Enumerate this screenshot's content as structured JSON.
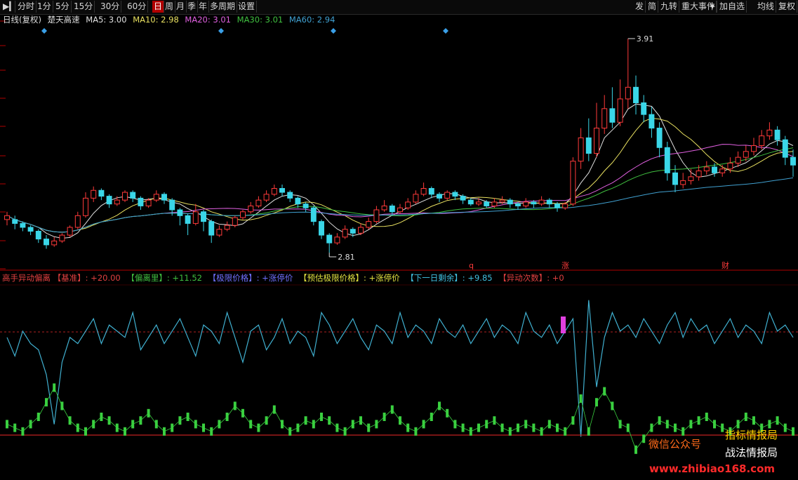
{
  "toolbar": {
    "items": [
      "分时",
      "1分",
      "5分",
      "15分",
      "30分",
      "60分",
      "日",
      "周",
      "月",
      "季",
      "年",
      "多周期",
      "设置"
    ],
    "active": "日",
    "right": [
      "发",
      "简",
      "九转",
      "重大事件",
      "加自选",
      "均线",
      "复权"
    ]
  },
  "main_title": {
    "period": "日线(复权)",
    "name": "楚天高速",
    "ma5": "MA5: 3.00",
    "ma10": "MA10: 2.98",
    "ma20": "MA20: 3.01",
    "ma30": "MA30: 3.01",
    "ma60": "MA60: 2.94",
    "colors": {
      "ma5": "#e0e0e0",
      "ma10": "#e8e060",
      "ma20": "#e060e0",
      "ma30": "#40c040",
      "ma60": "#40a0d0"
    }
  },
  "indicator_title": {
    "name": "高手异动偏离",
    "jizhun": "【基准】: +20.00",
    "pianli": "【偏离里】: +11.52",
    "jixian": "【极限价格】: +涨停价",
    "yugu": "【预估极限价格】: +涨停价",
    "shengyu": "【下一日剩余】: +9.85",
    "yidong": "【异动次数】: +0",
    "colors": {
      "name": "#e04040",
      "jizhun": "#e04040",
      "pianli": "#40c040",
      "jixian": "#7070ff",
      "yugu": "#e0e040",
      "shengyu": "#40c0e0",
      "yidong": "#e04040"
    }
  },
  "annotations": {
    "high": "3.91",
    "low": "2.81",
    "mark_q": "q",
    "mark_zhang": "涨",
    "mark_cai": "财"
  },
  "watermark": {
    "line1": "微信公众号",
    "line2": "指标情报局",
    "line3": "战法情报局",
    "url": "www.zhibiao168.com"
  },
  "chart_data": {
    "type": "candlestick",
    "price_range": [
      2.81,
      3.91
    ],
    "candles": [
      [
        2.98,
        3.0,
        2.95,
        3.02
      ],
      [
        2.98,
        2.96,
        2.93,
        3.0
      ],
      [
        2.96,
        2.94,
        2.92,
        2.97
      ],
      [
        2.94,
        2.92,
        2.9,
        2.95
      ],
      [
        2.92,
        2.88,
        2.86,
        2.93
      ],
      [
        2.88,
        2.85,
        2.83,
        2.9
      ],
      [
        2.85,
        2.87,
        2.84,
        2.89
      ],
      [
        2.87,
        2.9,
        2.86,
        2.91
      ],
      [
        2.9,
        2.94,
        2.89,
        2.95
      ],
      [
        2.94,
        3.0,
        2.93,
        3.02
      ],
      [
        3.0,
        3.09,
        2.99,
        3.12
      ],
      [
        3.09,
        3.13,
        3.07,
        3.15
      ],
      [
        3.13,
        3.1,
        3.08,
        3.14
      ],
      [
        3.1,
        3.06,
        3.04,
        3.11
      ],
      [
        3.06,
        3.08,
        3.05,
        3.1
      ],
      [
        3.08,
        3.12,
        3.07,
        3.13
      ],
      [
        3.12,
        3.09,
        3.07,
        3.13
      ],
      [
        3.09,
        3.05,
        3.03,
        3.1
      ],
      [
        3.05,
        3.08,
        3.04,
        3.09
      ],
      [
        3.08,
        3.11,
        3.07,
        3.13
      ],
      [
        3.11,
        3.08,
        3.06,
        3.12
      ],
      [
        3.08,
        3.03,
        3.0,
        3.09
      ],
      [
        3.03,
        3.0,
        2.95,
        3.04
      ],
      [
        3.0,
        2.96,
        2.9,
        3.01
      ],
      [
        2.96,
        3.02,
        2.95,
        3.06
      ],
      [
        3.02,
        2.97,
        2.92,
        3.03
      ],
      [
        2.97,
        2.9,
        2.86,
        2.98
      ],
      [
        2.9,
        2.93,
        2.89,
        2.95
      ],
      [
        2.93,
        2.95,
        2.92,
        2.97
      ],
      [
        2.95,
        2.99,
        2.94,
        3.0
      ],
      [
        2.99,
        3.02,
        2.98,
        3.03
      ],
      [
        3.02,
        3.05,
        3.01,
        3.07
      ],
      [
        3.05,
        3.08,
        3.04,
        3.1
      ],
      [
        3.08,
        3.11,
        3.07,
        3.13
      ],
      [
        3.11,
        3.14,
        3.1,
        3.16
      ],
      [
        3.14,
        3.12,
        3.1,
        3.16
      ],
      [
        3.12,
        3.09,
        3.07,
        3.13
      ],
      [
        3.09,
        3.06,
        3.04,
        3.1
      ],
      [
        3.06,
        3.04,
        3.02,
        3.07
      ],
      [
        3.04,
        2.97,
        2.95,
        3.05
      ],
      [
        2.97,
        2.9,
        2.88,
        2.98
      ],
      [
        2.9,
        2.86,
        2.81,
        2.91
      ],
      [
        2.86,
        2.89,
        2.85,
        2.91
      ],
      [
        2.89,
        2.93,
        2.88,
        2.95
      ],
      [
        2.93,
        2.91,
        2.89,
        2.94
      ],
      [
        2.91,
        2.94,
        2.9,
        2.96
      ],
      [
        2.94,
        2.97,
        2.93,
        2.99
      ],
      [
        2.97,
        3.03,
        2.96,
        3.05
      ],
      [
        3.03,
        3.05,
        3.02,
        3.08
      ],
      [
        3.05,
        3.02,
        3.0,
        3.06
      ],
      [
        3.02,
        3.04,
        3.01,
        3.06
      ],
      [
        3.04,
        3.07,
        3.03,
        3.09
      ],
      [
        3.07,
        3.11,
        3.06,
        3.13
      ],
      [
        3.11,
        3.14,
        3.1,
        3.17
      ],
      [
        3.14,
        3.11,
        3.09,
        3.15
      ],
      [
        3.11,
        3.09,
        3.07,
        3.12
      ],
      [
        3.09,
        3.12,
        3.08,
        3.13
      ],
      [
        3.12,
        3.1,
        3.08,
        3.13
      ],
      [
        3.1,
        3.08,
        3.06,
        3.11
      ],
      [
        3.08,
        3.06,
        3.05,
        3.09
      ],
      [
        3.06,
        3.07,
        3.05,
        3.09
      ],
      [
        3.07,
        3.05,
        3.04,
        3.08
      ],
      [
        3.05,
        3.07,
        3.04,
        3.09
      ],
      [
        3.07,
        3.08,
        3.06,
        3.1
      ],
      [
        3.08,
        3.06,
        3.04,
        3.09
      ],
      [
        3.06,
        3.05,
        3.03,
        3.07
      ],
      [
        3.05,
        3.07,
        3.04,
        3.09
      ],
      [
        3.07,
        3.06,
        3.04,
        3.08
      ],
      [
        3.06,
        3.08,
        3.05,
        3.1
      ],
      [
        3.08,
        3.06,
        3.04,
        3.09
      ],
      [
        3.06,
        3.04,
        3.02,
        3.07
      ],
      [
        3.04,
        3.06,
        3.03,
        3.07
      ],
      [
        3.06,
        3.28,
        3.05,
        3.3
      ],
      [
        3.28,
        3.4,
        3.24,
        3.45
      ],
      [
        3.4,
        3.32,
        3.28,
        3.5
      ],
      [
        3.32,
        3.45,
        3.3,
        3.58
      ],
      [
        3.45,
        3.55,
        3.42,
        3.62
      ],
      [
        3.55,
        3.48,
        3.45,
        3.66
      ],
      [
        3.48,
        3.6,
        3.46,
        3.7
      ],
      [
        3.6,
        3.66,
        3.55,
        3.91
      ],
      [
        3.66,
        3.58,
        3.52,
        3.72
      ],
      [
        3.58,
        3.52,
        3.48,
        3.62
      ],
      [
        3.52,
        3.45,
        3.4,
        3.56
      ],
      [
        3.45,
        3.35,
        3.3,
        3.48
      ],
      [
        3.35,
        3.22,
        3.18,
        3.38
      ],
      [
        3.22,
        3.16,
        3.12,
        3.26
      ],
      [
        3.16,
        3.18,
        3.14,
        3.22
      ],
      [
        3.18,
        3.2,
        3.16,
        3.24
      ],
      [
        3.2,
        3.23,
        3.18,
        3.26
      ],
      [
        3.23,
        3.25,
        3.21,
        3.28
      ],
      [
        3.25,
        3.22,
        3.2,
        3.27
      ],
      [
        3.22,
        3.24,
        3.2,
        3.26
      ],
      [
        3.24,
        3.27,
        3.22,
        3.3
      ],
      [
        3.27,
        3.3,
        3.25,
        3.33
      ],
      [
        3.3,
        3.33,
        3.28,
        3.36
      ],
      [
        3.33,
        3.36,
        3.31,
        3.4
      ],
      [
        3.36,
        3.41,
        3.34,
        3.44
      ],
      [
        3.41,
        3.44,
        3.39,
        3.48
      ],
      [
        3.44,
        3.39,
        3.36,
        3.46
      ],
      [
        3.39,
        3.3,
        3.26,
        3.41
      ],
      [
        3.3,
        3.26,
        3.2,
        3.34
      ]
    ],
    "indicator": {
      "baseline": 20.0,
      "line": [
        18,
        15,
        19,
        17,
        16,
        12,
        4,
        14,
        18,
        17,
        19,
        21,
        17,
        20,
        19,
        18,
        22,
        16,
        18,
        20,
        17,
        19,
        21,
        18,
        15,
        20,
        19,
        17,
        22,
        18,
        14,
        19,
        20,
        16,
        18,
        21,
        17,
        19,
        18,
        15,
        22,
        20,
        17,
        19,
        21,
        18,
        16,
        20,
        19,
        17,
        22,
        18,
        20,
        19,
        17,
        21,
        19,
        18,
        20,
        17,
        19,
        21,
        18,
        20,
        19,
        17,
        22,
        19,
        18,
        20,
        17,
        19,
        21,
        2,
        24,
        10,
        18,
        22,
        19,
        20,
        18,
        21,
        19,
        17,
        20,
        22,
        18,
        21,
        19,
        20,
        17,
        19,
        21,
        18,
        20,
        19,
        17,
        22,
        19,
        20,
        18
      ],
      "bars": [
        3,
        2,
        1,
        3,
        5,
        9,
        13,
        8,
        4,
        2,
        1,
        3,
        5,
        4,
        2,
        1,
        3,
        4,
        6,
        3,
        1,
        2,
        4,
        5,
        3,
        2,
        1,
        3,
        5,
        8,
        6,
        3,
        2,
        4,
        7,
        3,
        1,
        2,
        4,
        3,
        5,
        4,
        2,
        1,
        3,
        4,
        2,
        3,
        5,
        7,
        4,
        2,
        1,
        3,
        5,
        8,
        6,
        3,
        2,
        1,
        2,
        3,
        4,
        2,
        1,
        2,
        3,
        2,
        1,
        3,
        2,
        1,
        4,
        10,
        1,
        9,
        12,
        8,
        3,
        2,
        -4,
        -1,
        2,
        4,
        3,
        2,
        1,
        3,
        4,
        5,
        3,
        2,
        1,
        3,
        5,
        4,
        2,
        3,
        4,
        2,
        1
      ]
    }
  }
}
